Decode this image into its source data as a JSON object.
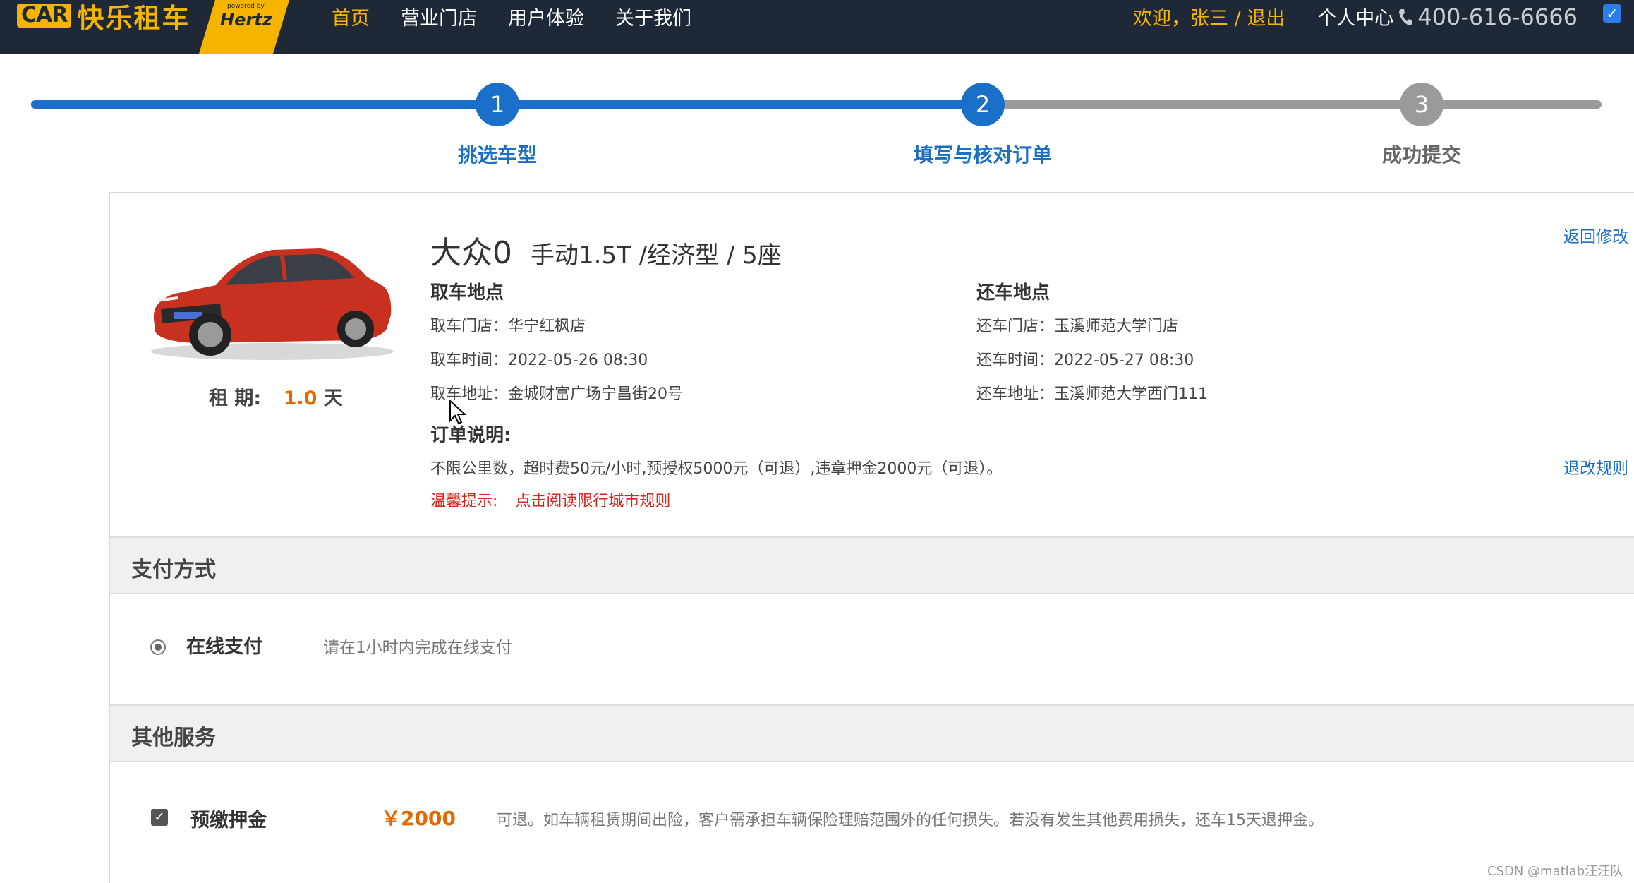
{
  "header": {
    "logo_car": "CAR",
    "logo_name": "快乐租车",
    "logo_powered": "powered by",
    "logo_hertz": "Hertz",
    "nav": [
      "首页",
      "营业门店",
      "用户体验",
      "关于我们"
    ],
    "welcome": "欢迎，张三 / 退出",
    "user_center": "个人中心",
    "phone": "400-616-6666"
  },
  "steps": [
    {
      "num": "1",
      "label": "挑选车型",
      "state": "done"
    },
    {
      "num": "2",
      "label": "填写与核对订单",
      "state": "active"
    },
    {
      "num": "3",
      "label": "成功提交",
      "state": "pending"
    }
  ],
  "car": {
    "name": "大众0",
    "spec": "手动1.5T /经济型 / 5座",
    "period_label": "租 期:",
    "period_value": "1.0",
    "period_unit": "天",
    "back_link": "返回修改"
  },
  "pickup": {
    "title": "取车地点",
    "store": "取车门店：华宁红枫店",
    "time": "取车时间：2022-05-26 08:30",
    "address": "取车地址：金城财富广场宁昌街20号"
  },
  "return": {
    "title": "还车地点",
    "store": "还车门店：玉溪师范大学门店",
    "time": "还车时间：2022-05-27 08:30",
    "address": "还车地址：玉溪师范大学西门111"
  },
  "order_note": {
    "title": "订单说明:",
    "text": "不限公里数，超时费50元/小时,预授权5000元（可退）,违章押金2000元（可退）。",
    "rules_link": "退改规则",
    "tip_label": "温馨提示:",
    "tip_link": "点击阅读限行城市规则"
  },
  "payment": {
    "section_title": "支付方式",
    "option": "在线支付",
    "hint": "请在1小时内完成在线支付"
  },
  "services": {
    "section_title": "其他服务",
    "deposit_label": "预缴押金",
    "deposit_price": "￥2000",
    "deposit_desc": "可退。如车辆租赁期间出险，客户需承担车辆保险理赔范围外的任何损失。若没有发生其他费用损失，还车15天退押金。"
  },
  "watermark": "CSDN @matlab汪汪队",
  "colors": {
    "nav_bg": "#1e2836",
    "accent": "#f5b400",
    "blue": "#1a6fc9",
    "orange": "#e06a00",
    "red": "#d9251d"
  }
}
